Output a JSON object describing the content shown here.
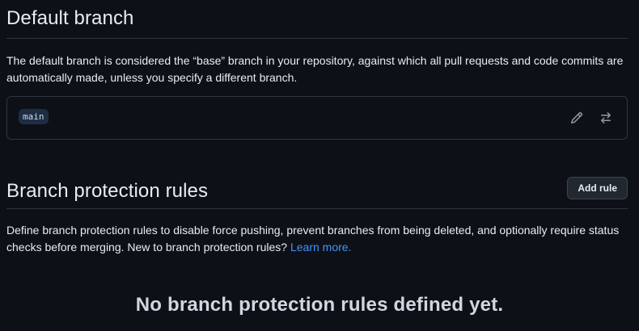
{
  "default_branch": {
    "title": "Default branch",
    "description": "The default branch is considered the “base” branch in your repository, against which all pull requests and code commits are automatically made, unless you specify a different branch.",
    "branch_name": "main",
    "edit_icon": "pencil-icon",
    "switch_icon": "arrow-switch-icon"
  },
  "protection_rules": {
    "title": "Branch protection rules",
    "add_rule_label": "Add rule",
    "description": "Define branch protection rules to disable force pushing, prevent branches from being deleted, and optionally require status checks before merging. New to branch protection rules?",
    "learn_more_label": "Learn more.",
    "empty_state": "No branch protection rules defined yet."
  },
  "colors": {
    "background": "#0d1117",
    "border": "#30363d",
    "link": "#4493f8",
    "text": "#e6edf3",
    "muted_icon": "#9198a1"
  }
}
